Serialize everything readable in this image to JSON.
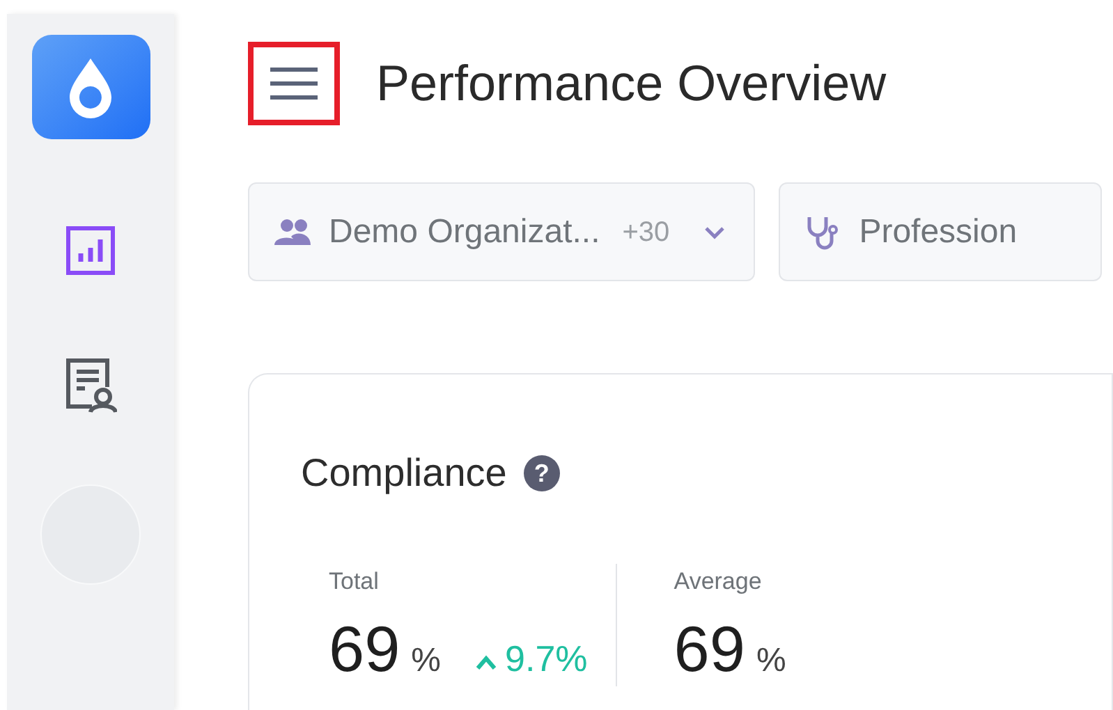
{
  "sidebar": {
    "items": [
      {
        "selected": true
      },
      {
        "selected": false
      }
    ]
  },
  "header": {
    "title": "Performance Overview",
    "menu_button": {
      "highlighted": true
    }
  },
  "filters": [
    {
      "label": "Demo Organizat...",
      "extra": "+30",
      "dropdown": true
    },
    {
      "label": "Profession",
      "dropdown": false
    }
  ],
  "card": {
    "title": "Compliance",
    "help": "?",
    "stats": [
      {
        "label": "Total",
        "value": "69",
        "unit": "%",
        "delta": {
          "text": "9.7%"
        }
      },
      {
        "label": "Average",
        "value": "69",
        "unit": "%"
      }
    ]
  }
}
